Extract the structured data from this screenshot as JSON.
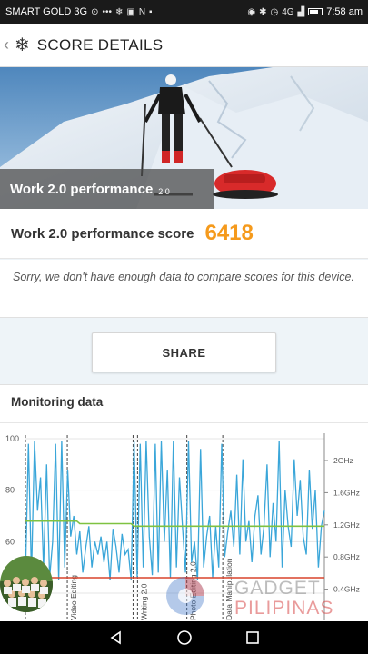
{
  "status": {
    "carrier": "SMART GOLD 3G",
    "signal": "4G",
    "time": "7:58 am"
  },
  "header": {
    "title": "SCORE DETAILS"
  },
  "hero": {
    "title": "Work 2.0 performance",
    "version": "2.0"
  },
  "score": {
    "label": "Work 2.0 performance score",
    "value": "6418"
  },
  "compare_note": "Sorry, we don't have enough data to compare scores for this device.",
  "share_label": "SHARE",
  "monitoring": {
    "title": "Monitoring data"
  },
  "watermark": {
    "line1": "GADGET",
    "line2": "PILIPINAS"
  },
  "colors": {
    "accent": "#f59a1c",
    "cpu_line": "#3aa6d9",
    "temp_line": "#7fc241",
    "battery_line": "#d9442c"
  },
  "chart_data": {
    "type": "line",
    "title": "",
    "xlabel": "",
    "ylabel": "",
    "ylim": [
      40,
      100
    ],
    "y_ticks": [
      "100",
      "80",
      "60",
      "40"
    ],
    "y2_ticks": [
      "2GHz",
      "1.6GHz",
      "1.2GHz",
      "0.8GHz",
      "0.4GHz"
    ],
    "x_range": [
      0,
      100
    ],
    "markers": [
      {
        "x": 0,
        "label": ""
      },
      {
        "x": 14,
        "label": "Video Editing"
      },
      {
        "x": 36,
        "label": ""
      },
      {
        "x": 37.5,
        "label": "Writing 2.0"
      },
      {
        "x": 54,
        "label": "Photo Editing 2.0"
      },
      {
        "x": 66,
        "label": "Data Manipulation"
      }
    ],
    "series": [
      {
        "name": "",
        "values": [
          46,
          98,
          47,
          99,
          72,
          85,
          50,
          90,
          46,
          60,
          98,
          45,
          99,
          50,
          88,
          62,
          70,
          55,
          64,
          48,
          58,
          66,
          50,
          60,
          55,
          62,
          52,
          60,
          45,
          65,
          58,
          48,
          63,
          55,
          57,
          45,
          99,
          46,
          98,
          50,
          99,
          62,
          47,
          98,
          48,
          99,
          60,
          88,
          46,
          99,
          50,
          85,
          66,
          48,
          99,
          52,
          60,
          45,
          96,
          50,
          62,
          70,
          46,
          66,
          50,
          98,
          54,
          64,
          72,
          58,
          86,
          55,
          92,
          60,
          68,
          52,
          70,
          78,
          55,
          66,
          90,
          54,
          75,
          60,
          99,
          50,
          80,
          66,
          58,
          92,
          70,
          84,
          62,
          55,
          88,
          65,
          80,
          50,
          66,
          72
        ]
      },
      {
        "name": "",
        "values": [
          68,
          68,
          68,
          68,
          68,
          68,
          68,
          68,
          68,
          68,
          68,
          68,
          68,
          68,
          68,
          68,
          68,
          68,
          67,
          67,
          67,
          67,
          67,
          67,
          67,
          67,
          67,
          67,
          67,
          67,
          67,
          67,
          67,
          67,
          67,
          67,
          66,
          66,
          66,
          66,
          66,
          66,
          66,
          66,
          66,
          66,
          66,
          66,
          66,
          66,
          66,
          66,
          66,
          66,
          66,
          66,
          66,
          66,
          66,
          66,
          66,
          66,
          66,
          66,
          66,
          66,
          66,
          66,
          66,
          66,
          66,
          66,
          66,
          66,
          66,
          66,
          66,
          66,
          66,
          66,
          66,
          66,
          66,
          66,
          66,
          66,
          66,
          66,
          66,
          66,
          66,
          66,
          66,
          66,
          66,
          66,
          66,
          66,
          66,
          66
        ]
      },
      {
        "name": "",
        "values": [
          46,
          46,
          46,
          46,
          46,
          46,
          46,
          46,
          46,
          46,
          46,
          46,
          46,
          46,
          46,
          46,
          46,
          46,
          46,
          46,
          46,
          46,
          46,
          46,
          46,
          46,
          46,
          46,
          46,
          46,
          46,
          46,
          46,
          46,
          46,
          46,
          46,
          46,
          46,
          46,
          46,
          46,
          46,
          46,
          46,
          46,
          46,
          46,
          46,
          46,
          46,
          46,
          46,
          46,
          46,
          46,
          46,
          46,
          46,
          46,
          46,
          46,
          46,
          46,
          46,
          46,
          46,
          46,
          46,
          46,
          46,
          46,
          46,
          46,
          46,
          46,
          46,
          46,
          46,
          46,
          46,
          46,
          46,
          46,
          46,
          46,
          46,
          46,
          46,
          46,
          46,
          46,
          46,
          46,
          46,
          46,
          46,
          46,
          46,
          46
        ]
      }
    ]
  }
}
